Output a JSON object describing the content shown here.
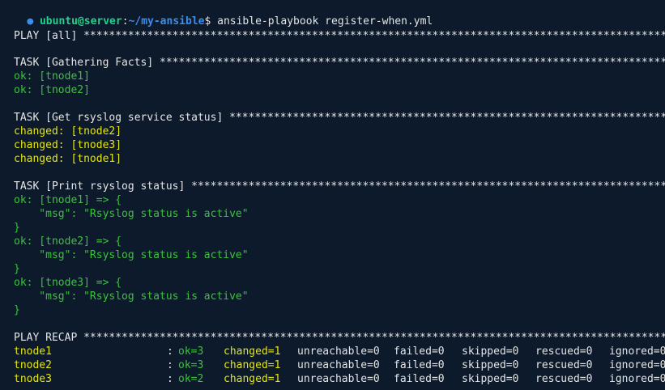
{
  "prompt": {
    "dot": "●",
    "user_host": "ubuntu@server",
    "colon": ":",
    "path": "~/my-ansible",
    "dollar": "$",
    "command": " ansible-playbook register-when.yml"
  },
  "play_header": "PLAY [all] ******************************************************************************************************",
  "task1": {
    "header": "TASK [Gathering Facts] ******************************************************************************************",
    "lines": [
      "ok: [tnode1]",
      "ok: [tnode2]"
    ]
  },
  "task2": {
    "header": "TASK [Get rsyslog service status] ***********************************************************************",
    "lines": [
      "changed: [tnode2]",
      "changed: [tnode3]",
      "changed: [tnode1]"
    ]
  },
  "task3": {
    "header": "TASK [Print rsyslog status] *****************************************************************************",
    "blocks": [
      {
        "open": "ok: [tnode1] => {",
        "msg": "    \"msg\": \"Rsyslog status is active\"",
        "close": "}"
      },
      {
        "open": "ok: [tnode2] => {",
        "msg": "    \"msg\": \"Rsyslog status is active\"",
        "close": "}"
      },
      {
        "open": "ok: [tnode3] => {",
        "msg": "    \"msg\": \"Rsyslog status is active\"",
        "close": "}"
      }
    ]
  },
  "recap": {
    "header": "PLAY RECAP ******************************************************************************************************",
    "rows": [
      {
        "host": "tnode1",
        "sep": ":",
        "ok": "ok=3",
        "changed": "changed=1",
        "unreachable": "unreachable=0",
        "failed": "failed=0",
        "skipped": "skipped=0",
        "rescued": "rescued=0",
        "ignored": "ignored=0"
      },
      {
        "host": "tnode2",
        "sep": ":",
        "ok": "ok=3",
        "changed": "changed=1",
        "unreachable": "unreachable=0",
        "failed": "failed=0",
        "skipped": "skipped=0",
        "rescued": "rescued=0",
        "ignored": "ignored=0"
      },
      {
        "host": "tnode3",
        "sep": ":",
        "ok": "ok=2",
        "changed": "changed=1",
        "unreachable": "unreachable=0",
        "failed": "failed=0",
        "skipped": "skipped=0",
        "rescued": "rescued=0",
        "ignored": "ignored=0"
      }
    ]
  },
  "colors": {
    "background": "#0c1a2b",
    "ok_green": "#3cc33c",
    "changed_yellow": "#e5e510",
    "text_white": "#e5e5e5",
    "prompt_blue": "#3b8eea"
  }
}
